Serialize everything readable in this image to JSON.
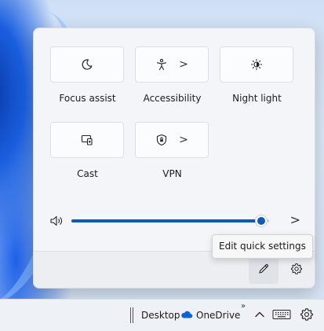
{
  "quick_settings": {
    "tiles": [
      {
        "label": "Focus assist",
        "icon": "moon-icon",
        "has_chevron": false
      },
      {
        "label": "Accessibility",
        "icon": "accessibility-icon",
        "has_chevron": true
      },
      {
        "label": "Night light",
        "icon": "night-light-icon",
        "has_chevron": false
      },
      {
        "label": "Cast",
        "icon": "cast-icon",
        "has_chevron": false
      },
      {
        "label": "VPN",
        "icon": "shield-icon",
        "has_chevron": true
      }
    ],
    "chevron_glyph": ">",
    "volume": {
      "level": 0.96,
      "icon": "speaker-icon",
      "next_glyph": ">"
    },
    "footer": {
      "edit_tooltip": "Edit quick settings",
      "edit_icon": "pencil-icon",
      "settings_icon": "gear-icon"
    }
  },
  "taskbar": {
    "desktop_label": "Desktop",
    "onedrive_label": "OneDrive",
    "more_glyph": "»",
    "tray_up_icon": "chevron-up-icon",
    "keyboard_icon": "keyboard-icon",
    "settings_icon": "gear-icon"
  },
  "colors": {
    "accent": "#0f5ab4",
    "panel_bg": "#f3f5f9",
    "tile_bg": "#fbfcfd",
    "onedrive_blue": "#0a64d6"
  }
}
